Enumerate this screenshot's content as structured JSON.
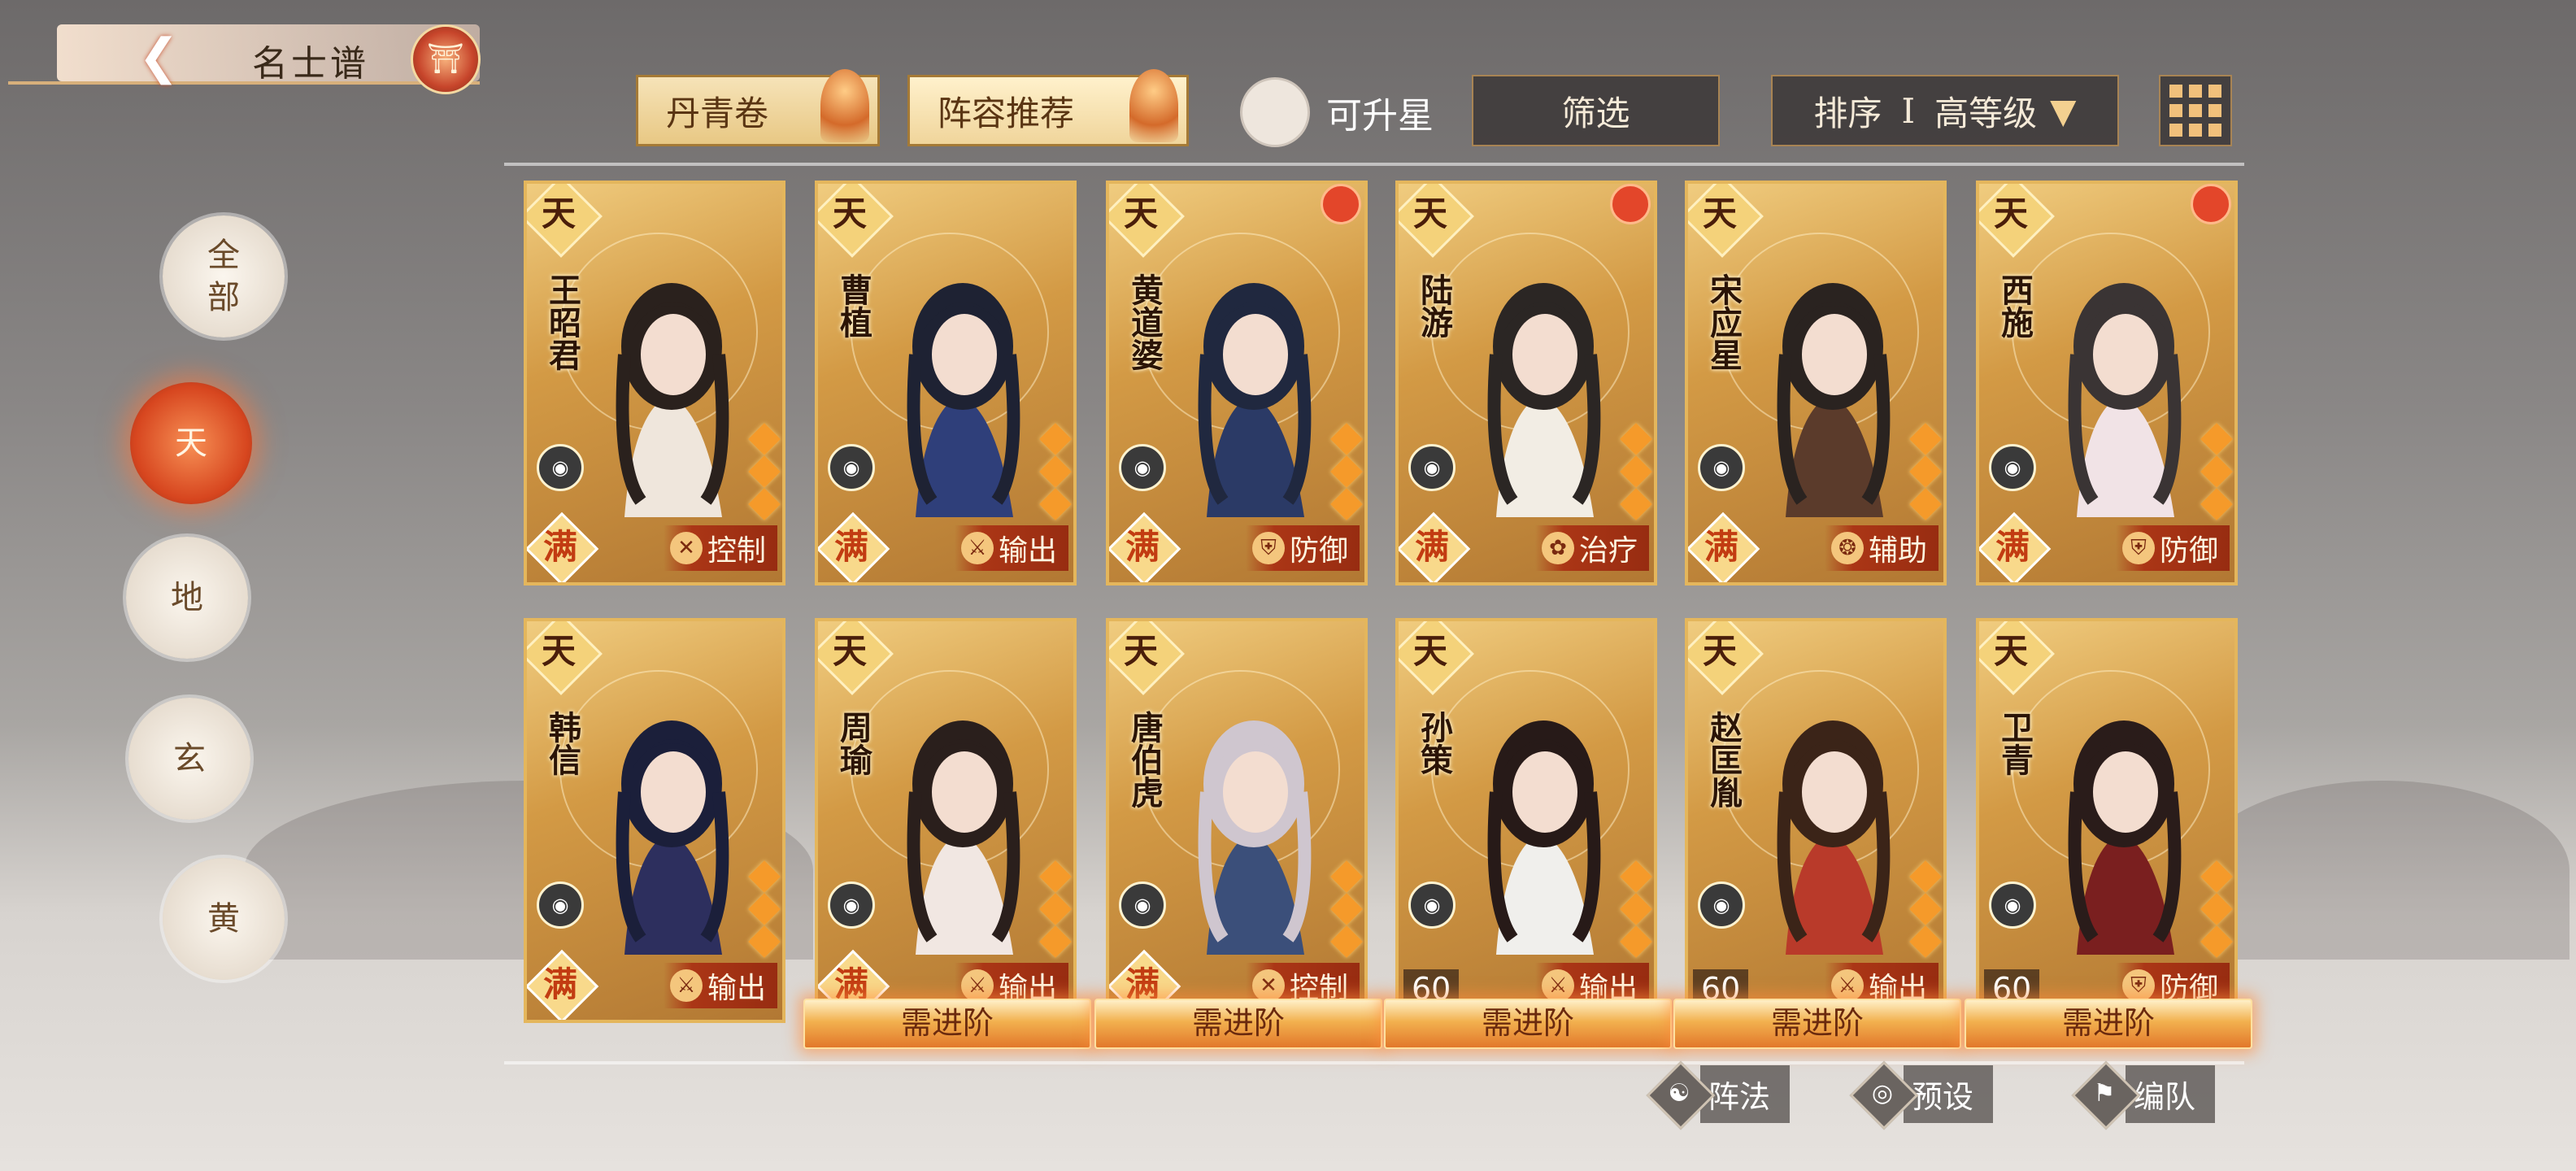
{
  "header": {
    "back_icon": "back-arrow-icon",
    "title": "名士谱",
    "emblem_icon": "pagoda-icon"
  },
  "tabs": [
    {
      "label": "丹青卷",
      "active": false
    },
    {
      "label": "阵容推荐",
      "active": true
    }
  ],
  "filters": {
    "upgrade_toggle_label": "可升星",
    "filter_label": "筛选",
    "sort_label": "排序",
    "sort_separator": "I",
    "sort_value": "高等级",
    "view_icon": "grid-view-icon"
  },
  "categories": [
    {
      "label": "全\n部",
      "active": false
    },
    {
      "label": "天",
      "active": true
    },
    {
      "label": "地",
      "active": false
    },
    {
      "label": "玄",
      "active": false
    },
    {
      "label": "黄",
      "active": false
    }
  ],
  "cards": [
    {
      "tier": "天",
      "name": "王昭君",
      "star_badge": "满",
      "level": "",
      "role": "控制",
      "role_icon": "control-icon",
      "red_dot": false,
      "need_advance": false
    },
    {
      "tier": "天",
      "name": "曹植",
      "star_badge": "满",
      "level": "",
      "role": "输出",
      "role_icon": "sword-icon",
      "red_dot": false,
      "need_advance": false
    },
    {
      "tier": "天",
      "name": "黄道婆",
      "star_badge": "满",
      "level": "",
      "role": "防御",
      "role_icon": "shield-icon",
      "red_dot": true,
      "need_advance": false
    },
    {
      "tier": "天",
      "name": "陆游",
      "star_badge": "满",
      "level": "",
      "role": "治疗",
      "role_icon": "sprout-icon",
      "red_dot": true,
      "need_advance": false
    },
    {
      "tier": "天",
      "name": "宋应星",
      "star_badge": "满",
      "level": "",
      "role": "辅助",
      "role_icon": "support-icon",
      "red_dot": false,
      "need_advance": false
    },
    {
      "tier": "天",
      "name": "西施",
      "star_badge": "满",
      "level": "",
      "role": "防御",
      "role_icon": "shield-icon",
      "red_dot": true,
      "need_advance": false
    },
    {
      "tier": "天",
      "name": "韩信",
      "star_badge": "满",
      "level": "",
      "role": "输出",
      "role_icon": "sword-icon",
      "red_dot": false,
      "need_advance": false
    },
    {
      "tier": "天",
      "name": "周瑜",
      "star_badge": "满",
      "level": "",
      "role": "输出",
      "role_icon": "sword-icon",
      "red_dot": false,
      "need_advance": true
    },
    {
      "tier": "天",
      "name": "唐伯虎",
      "star_badge": "满",
      "level": "",
      "role": "控制",
      "role_icon": "control-icon",
      "red_dot": false,
      "need_advance": true
    },
    {
      "tier": "天",
      "name": "孙策",
      "star_badge": "",
      "level": "60",
      "role": "输出",
      "role_icon": "sword-icon",
      "red_dot": false,
      "need_advance": true
    },
    {
      "tier": "天",
      "name": "赵匡胤",
      "star_badge": "",
      "level": "60",
      "role": "输出",
      "role_icon": "sword-icon",
      "red_dot": false,
      "need_advance": true
    },
    {
      "tier": "天",
      "name": "卫青",
      "star_badge": "",
      "level": "60",
      "role": "防御",
      "role_icon": "shield-icon",
      "red_dot": false,
      "need_advance": true
    }
  ],
  "need_advance_label": "需进阶",
  "actions": [
    {
      "label": "阵法",
      "icon": "formation-icon"
    },
    {
      "label": "预设",
      "icon": "preset-icon"
    },
    {
      "label": "编队",
      "icon": "team-flag-icon"
    }
  ],
  "colors": {
    "accent_orange": "#e2782b",
    "card_gold": "#d39a45",
    "role_red": "#aa3214",
    "active_category": "#d7461f"
  }
}
